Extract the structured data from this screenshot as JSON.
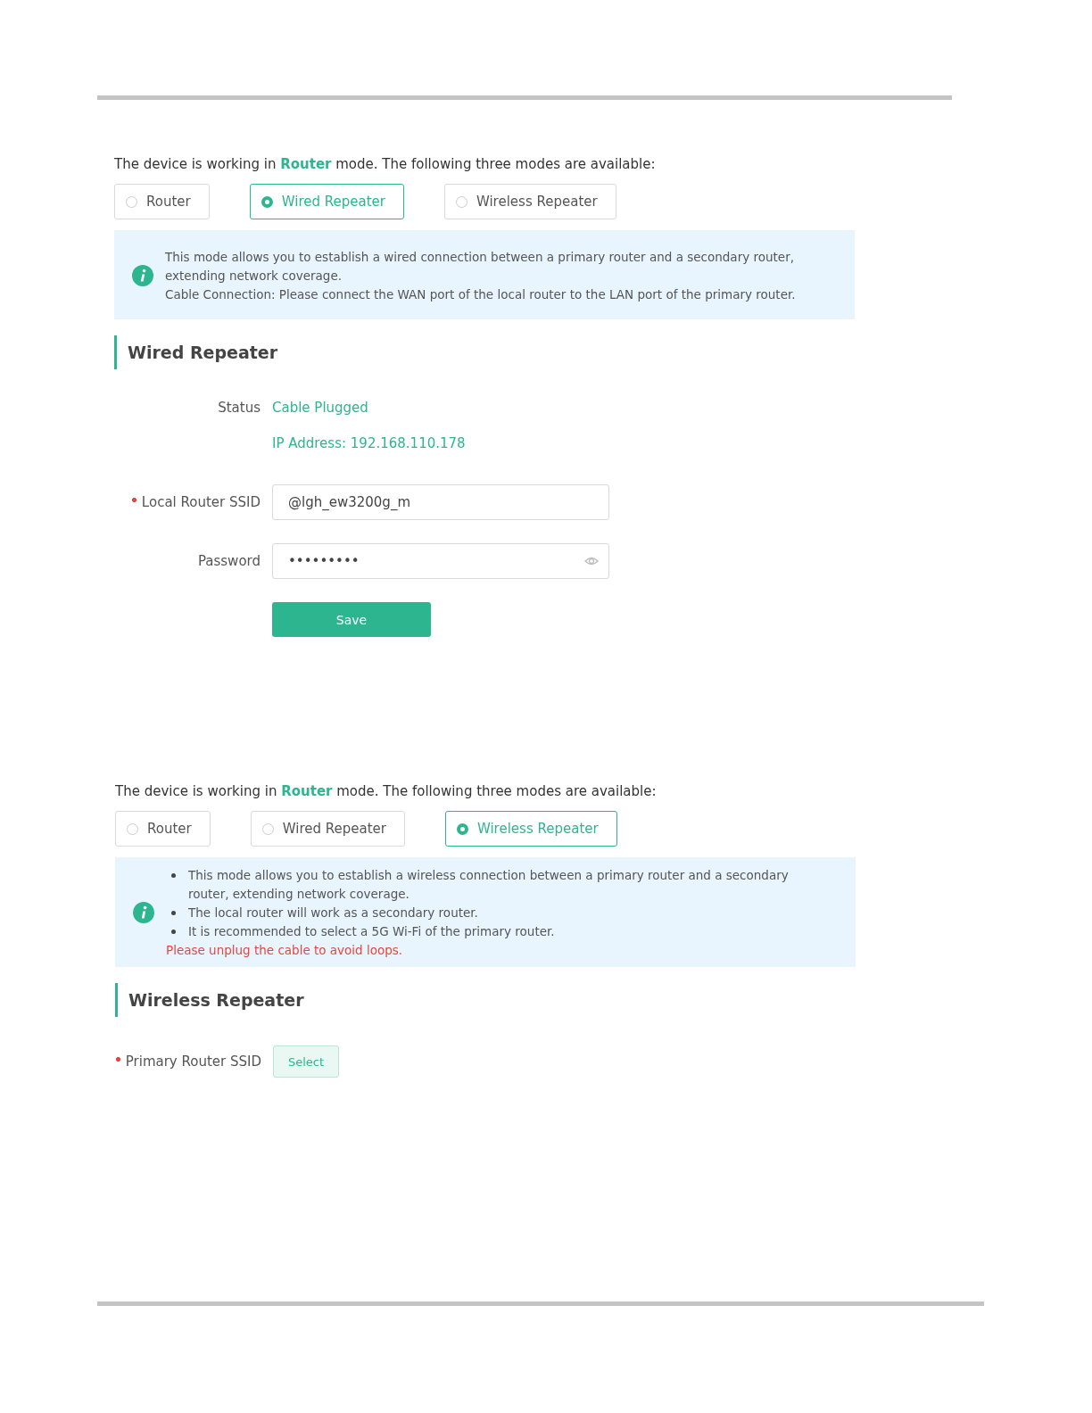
{
  "panels": [
    {
      "intro": "The device is working in **Router** mode. The following three modes are available:",
      "modes": [
        {
          "label": "Router",
          "selected": false
        },
        {
          "label": "Wired Repeater",
          "selected": true
        },
        {
          "label": "Wireless Repeater",
          "selected": false
        }
      ],
      "notice": {
        "kind": "paragraphs",
        "lines": [
          "This mode allows you to establish a wired connection between a primary router and a secondary router, extending network coverage.",
          "Cable Connection: Please connect the WAN port of the local router to the LAN port of the primary router."
        ]
      },
      "section": {
        "title": "Wired Repeater",
        "fields": [
          {
            "kind": "status",
            "label": "Status",
            "values": [
              "Cable Plugged",
              "IP Address: 192.168.110.178"
            ]
          },
          {
            "kind": "text",
            "label": "Local Router SSID",
            "required": true,
            "value": "@lgh_ew3200g_m"
          },
          {
            "kind": "password",
            "label": "Password",
            "required": false,
            "value": "•••••••••"
          },
          {
            "kind": "action",
            "text": "Save"
          }
        ]
      }
    },
    {
      "intro": "The device is working in **Router** mode. The following three modes are available:",
      "modes": [
        {
          "label": "Router",
          "selected": false
        },
        {
          "label": "Wired Repeater",
          "selected": false
        },
        {
          "label": "Wireless Repeater",
          "selected": true
        }
      ],
      "notice": {
        "kind": "bullets",
        "lines": [
          "This mode allows you to establish a wireless connection between a primary router and a secondary router, extending network coverage.",
          "The local router will work as a secondary router.",
          "It is recommended to select a 5G Wi-Fi of the primary router."
        ],
        "warning": "Please unplug the cable to avoid loops."
      },
      "section": {
        "title": "Wireless Repeater",
        "fields": [
          {
            "kind": "picker",
            "label": "Primary Router SSID",
            "required": true,
            "text": "Select"
          }
        ]
      }
    }
  ]
}
